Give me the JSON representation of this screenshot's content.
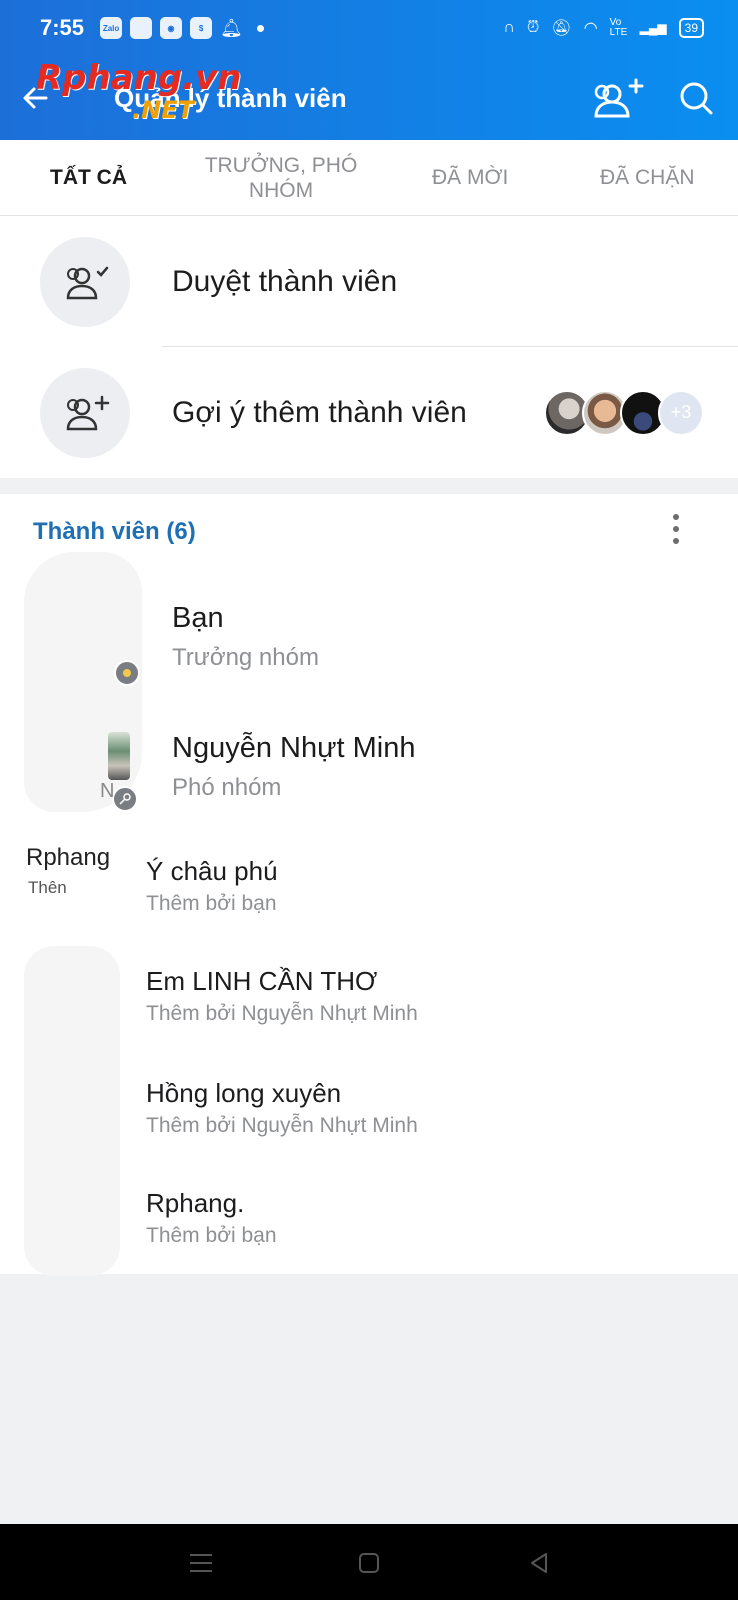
{
  "status_bar": {
    "time": "7:55",
    "left_icons": [
      "zalo-icon",
      "app-icon",
      "camera-icon",
      "shopee-icon",
      "bell-icon"
    ],
    "right_icons": [
      "headset-icon",
      "alarm-icon",
      "mute-icon",
      "wifi-icon",
      "volte-icon",
      "signal-icon"
    ],
    "zalo_label": "Zalo",
    "volte_label": "Vo LTE",
    "battery": "39"
  },
  "header": {
    "title": "Quản lý thành viên",
    "watermark": "Rphang.vn",
    "watermark_sub": ".NET",
    "background": "#1d6fd8"
  },
  "tabs": [
    {
      "label": "TẤT CẢ",
      "active": true
    },
    {
      "label": "TRƯỞNG, PHÓ NHÓM",
      "active": false
    },
    {
      "label": "ĐÃ MỜI",
      "active": false
    },
    {
      "label": "ĐÃ CHẶN",
      "active": false
    }
  ],
  "actions": [
    {
      "label": "Duyệt thành viên",
      "icon": "users-check-icon"
    },
    {
      "label": "Gợi ý thêm thành viên",
      "icon": "user-add-icon",
      "more_count": "+3"
    }
  ],
  "members": {
    "title": "Thành viên (6)",
    "accent": "#1f6fb5",
    "list": [
      {
        "name": "Bạn",
        "subtitle": "Trưởng nhóm"
      },
      {
        "name": "Nguyễn Nhựt Minh",
        "subtitle": "Phó nhóm"
      },
      {
        "name": "Ý châu phú",
        "subtitle": "Thêm bởi bạn"
      },
      {
        "name": "Em LINH CẦN THƠ",
        "subtitle": "Thêm bởi Nguyễn Nhựt Minh"
      },
      {
        "name": "Hồng long xuyên",
        "subtitle": "Thêm bởi Nguyễn Nhựt Minh"
      },
      {
        "name": "Rphang.",
        "subtitle": "Thêm bởi bạn"
      }
    ],
    "avatar_fragment_name": "Rphang",
    "avatar_fragment_sub": "Thên",
    "avatar_fragment_letter": "N"
  },
  "nav": {
    "buttons": [
      "menu-icon",
      "home-icon",
      "back-icon"
    ]
  }
}
